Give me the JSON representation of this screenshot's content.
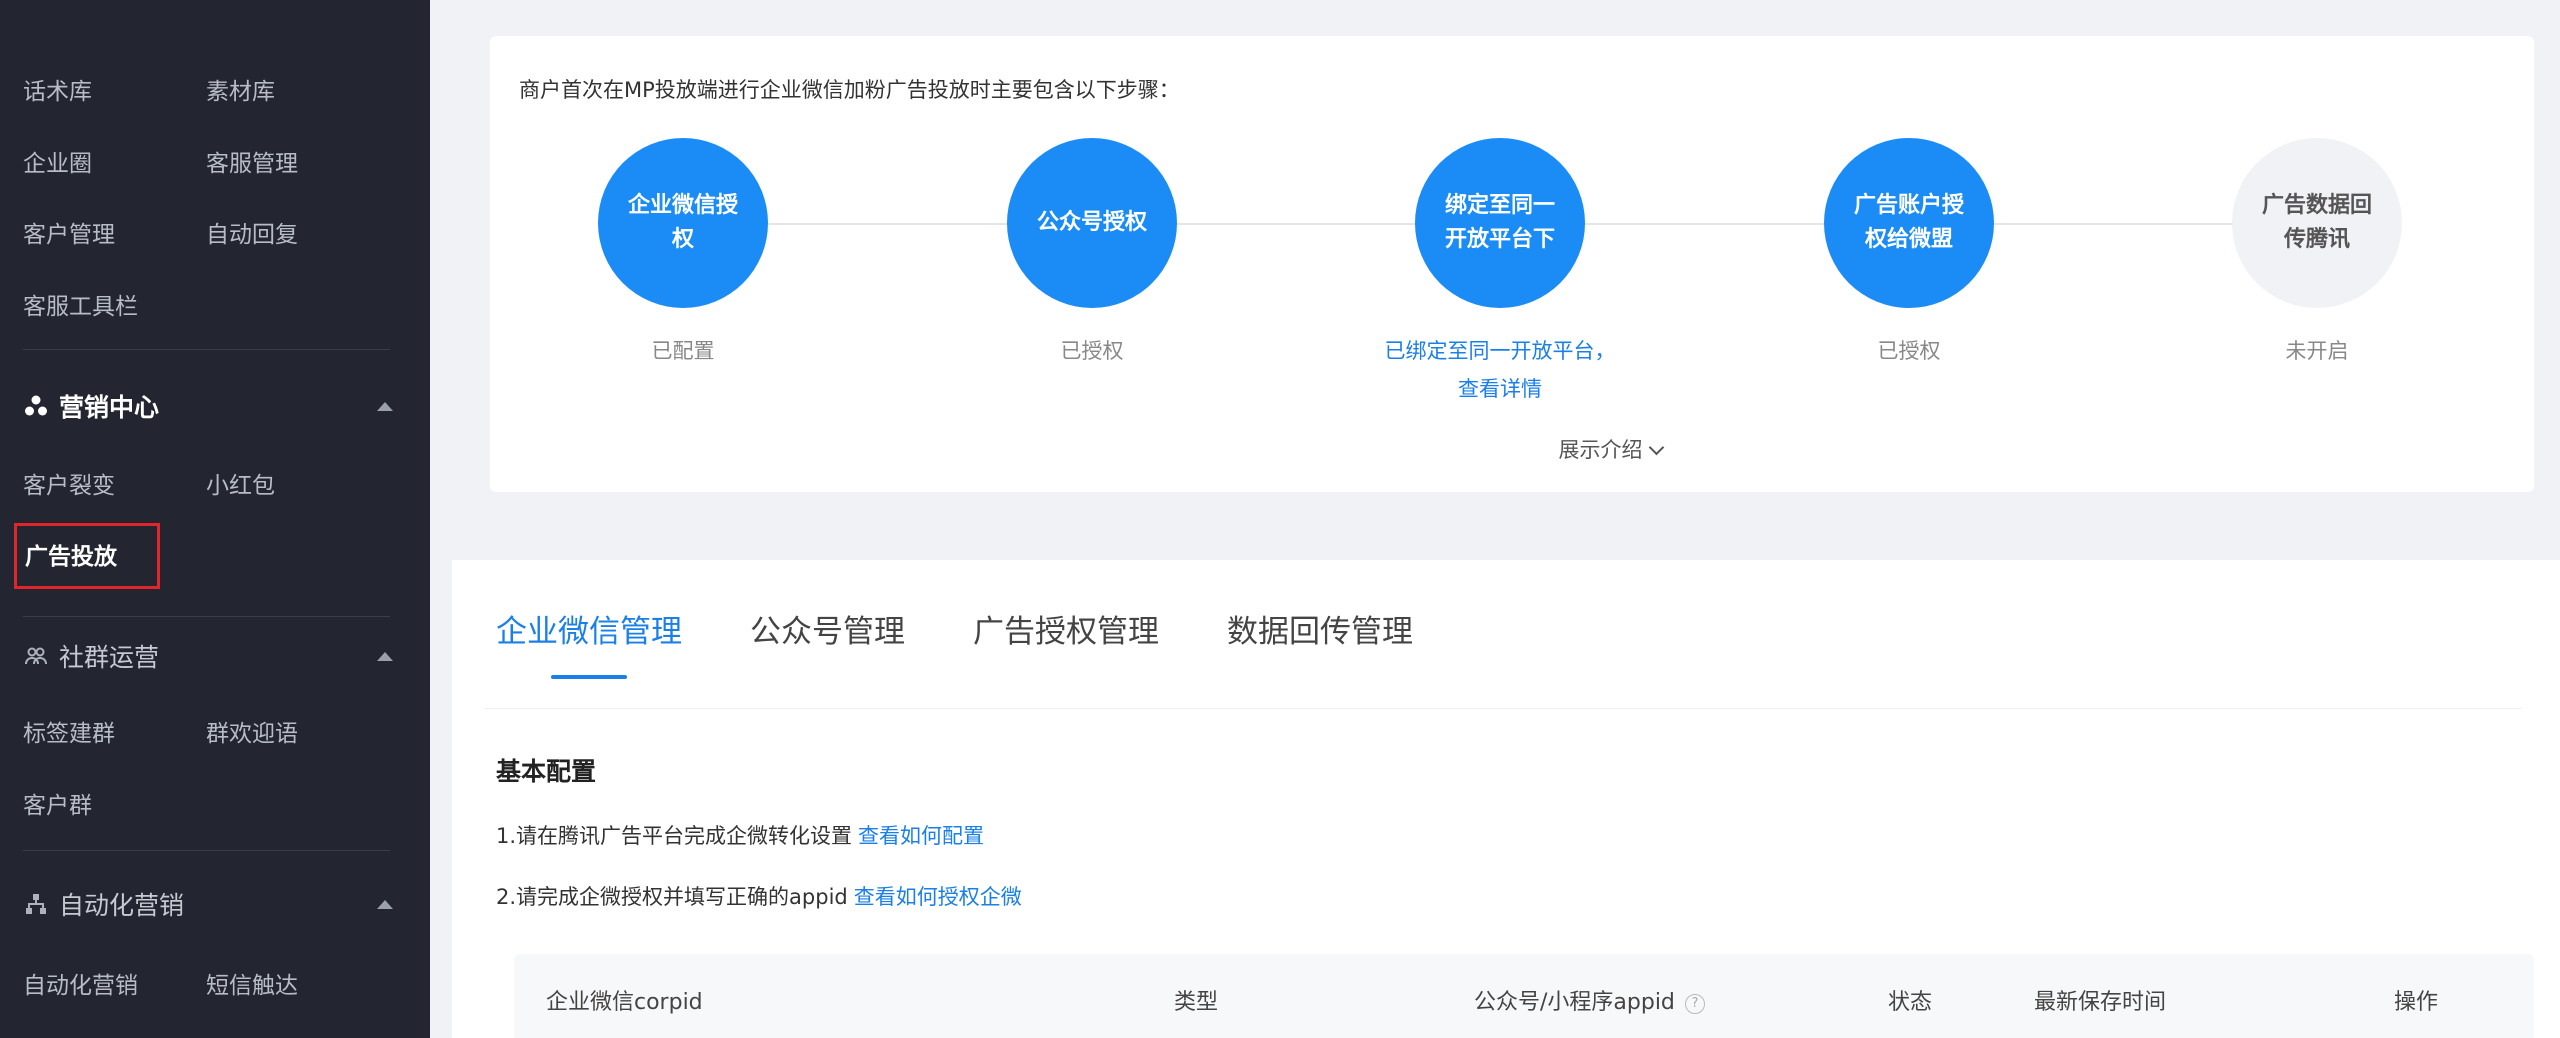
{
  "sidebar": {
    "rows_top": [
      [
        "话术库",
        "素材库"
      ],
      [
        "企业圈",
        "客服管理"
      ],
      [
        "客户管理",
        "自动回复"
      ],
      [
        "客服工具栏",
        ""
      ]
    ],
    "marketing": {
      "title": "营销中心",
      "items": [
        "客户裂变",
        "小红包"
      ],
      "active_item": "广告投放"
    },
    "community": {
      "title": "社群运营",
      "rows": [
        [
          "标签建群",
          "群欢迎语"
        ],
        [
          "客户群",
          ""
        ]
      ]
    },
    "automation": {
      "title": "自动化营销",
      "items": [
        "自动化营销",
        "短信触达"
      ]
    }
  },
  "intro": {
    "text": "商户首次在MP投放端进行企业微信加粉广告投放时主要包含以下步骤：",
    "expand": "展示介绍"
  },
  "steps": [
    {
      "label": "企业微信授权",
      "status": "已配置",
      "enabled": true
    },
    {
      "label": "公众号授权",
      "status": "已授权",
      "enabled": true
    },
    {
      "label": "绑定至同一开放平台下",
      "status": "已绑定至同一开放平台，",
      "status2": "查看详情",
      "enabled": true
    },
    {
      "label": "广告账户授权给微盟",
      "status": "已授权",
      "enabled": true
    },
    {
      "label": "广告数据回传腾讯",
      "status": "未开启",
      "enabled": false
    }
  ],
  "tabs": [
    "企业微信管理",
    "公众号管理",
    "广告授权管理",
    "数据回传管理"
  ],
  "active_tab": 0,
  "config": {
    "title": "基本配置",
    "line1": "1.请在腾讯广告平台完成企微转化设置",
    "line1_link": "查看如何配置",
    "line2": "2.请完成企微授权并填写正确的appid",
    "line2_link": "查看如何授权企微"
  },
  "table": {
    "columns": [
      "企业微信corpid",
      "类型",
      "公众号/小程序appid",
      "状态",
      "最新保存时间",
      "操作"
    ],
    "help_glyph": "?"
  },
  "colors": {
    "primary": "#1b8cf6",
    "sidebar_bg": "#232631",
    "highlight_border": "#e0262b"
  }
}
